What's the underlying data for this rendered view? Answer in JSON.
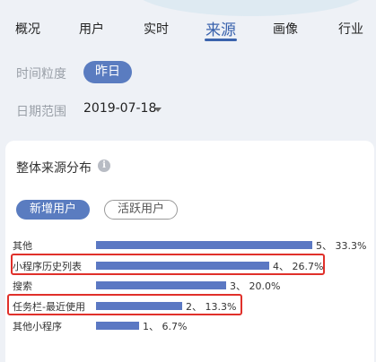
{
  "tabs": [
    "概况",
    "用户",
    "实时",
    "来源",
    "画像",
    "行业"
  ],
  "active_tab": "来源",
  "filters": {
    "granularity_label": "时间粒度",
    "granularity_value": "昨日",
    "date_label": "日期范围",
    "date_value": "2019-07-18"
  },
  "section": {
    "title": "整体来源分布",
    "toggle_active": "新增用户",
    "toggle_inactive": "活跃用户"
  },
  "colors": {
    "accent": "#5a7cc0",
    "bar": "#5b78c3",
    "highlight": "#e0302a"
  },
  "chart_data": {
    "type": "bar",
    "orientation": "horizontal",
    "categories": [
      "其他",
      "小程序历史列表",
      "搜索",
      "任务栏-最近使用",
      "其他小程序"
    ],
    "values": [
      5,
      4,
      3,
      2,
      1
    ],
    "percent_labels": [
      "33.3%",
      "26.7%",
      "20.0%",
      "13.3%",
      "6.7%"
    ],
    "value_labels": [
      "5、 33.3%",
      "4、 26.7%",
      "3、 20.0%",
      "2、 13.3%",
      "1、 6.7%"
    ],
    "highlighted_rows": [
      1,
      3
    ]
  }
}
